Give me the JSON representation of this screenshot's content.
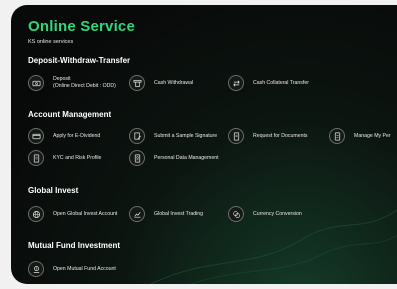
{
  "header": {
    "title": "Online Service",
    "subtitle": "KS online services"
  },
  "sections": {
    "deposit": {
      "title": "Deposit-Withdraw-Transfer",
      "items": [
        {
          "label": "Deposit",
          "sublabel": "(Online Direct Debit : ODD)",
          "icon": "deposit-icon"
        },
        {
          "label": "Cash Withdrawal",
          "icon": "cash-withdrawal-icon"
        },
        {
          "label": "Cash Collateral Transfer",
          "icon": "transfer-arrows-icon"
        }
      ]
    },
    "account": {
      "title": "Account Management",
      "items": [
        {
          "label": "Apply for E-Dividend",
          "icon": "card-icon"
        },
        {
          "label": "Submit a Sample Signature",
          "icon": "signature-icon"
        },
        {
          "label": "Request for Documents",
          "icon": "document-icon"
        },
        {
          "label": "Manage My Per",
          "icon": "profile-document-icon"
        },
        {
          "label": "KYC and Risk Profile",
          "icon": "kyc-document-icon"
        },
        {
          "label": "Personal Data Management",
          "icon": "personal-data-icon"
        }
      ]
    },
    "global": {
      "title": "Global Invest",
      "items": [
        {
          "label": "Open Global Invest Account",
          "icon": "globe-icon"
        },
        {
          "label": "Global Invest Trading",
          "icon": "chart-icon"
        },
        {
          "label": "Currency Conversion",
          "icon": "currency-conversion-icon"
        }
      ]
    },
    "mutual": {
      "title": "Mutual Fund Investment",
      "items": [
        {
          "label": "Open Mutual Fund Account",
          "icon": "mutual-fund-icon"
        }
      ]
    }
  },
  "colors": {
    "accent": "#2fd67c",
    "background": "#0a0d0b",
    "icon_border": "#6a6f6c"
  }
}
